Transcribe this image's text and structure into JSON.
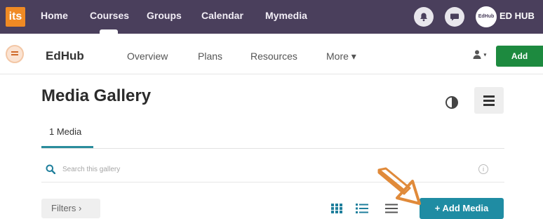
{
  "topnav": {
    "logo": "its",
    "links": [
      "Home",
      "Courses",
      "Groups",
      "Calendar",
      "Mymedia"
    ],
    "avatar_text": "EdHub",
    "user_name": "ED HUB"
  },
  "subnav": {
    "channel_name": "EdHub",
    "links": [
      "Overview",
      "Plans",
      "Resources",
      "More ▾"
    ],
    "add_label": "Add"
  },
  "page": {
    "title": "Media Gallery",
    "tab_label": "1 Media",
    "search_placeholder": "Search this gallery",
    "filters_label": "Filters ›",
    "add_media_label": "+ Add Media"
  },
  "colors": {
    "topnav": "#4a3f5c",
    "accent_teal": "#1f8ca3",
    "add_green": "#1d8a3f",
    "annotation_arrow": "#e08a3a"
  }
}
